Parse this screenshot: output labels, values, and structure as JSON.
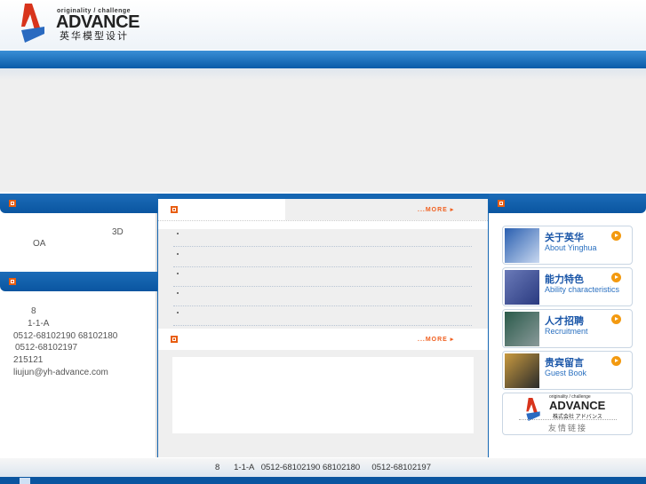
{
  "header": {
    "logo_tagline": "originality / challenge",
    "logo_name": "ADVANCE",
    "logo_cn": "英华模型设计"
  },
  "left": {
    "intro_lines": [
      "3D",
      "OA"
    ],
    "contact_lines": [
      "8",
      "1-1-A",
      "0512-68102190 68102180",
      "0512-68102197",
      "215121",
      "liujun@yh-advance.com"
    ]
  },
  "middle": {
    "more_label": "...MORE ▸",
    "list_count": 5
  },
  "right": {
    "cards": [
      {
        "cn": "关于英华",
        "en": "About Yinghua",
        "thumb": "#3d6fb0"
      },
      {
        "cn": "能力特色",
        "en": "Ability characteristics",
        "thumb": "#4a5aa0"
      },
      {
        "cn": "人才招聘",
        "en": "Recruitment",
        "thumb": "#3a6a5a"
      },
      {
        "cn": "贵宾留言",
        "en": "Guest Book",
        "thumb": "#8a6a30"
      }
    ],
    "partner_name": "ADVANCE",
    "partner_tagline": "originality / challenge",
    "partner_jp": "株式会社 アドバンス",
    "partner_label": "友情链接"
  },
  "footer": {
    "address": "8      1-1-A   0512-68102190 68102180     0512-68102197"
  }
}
